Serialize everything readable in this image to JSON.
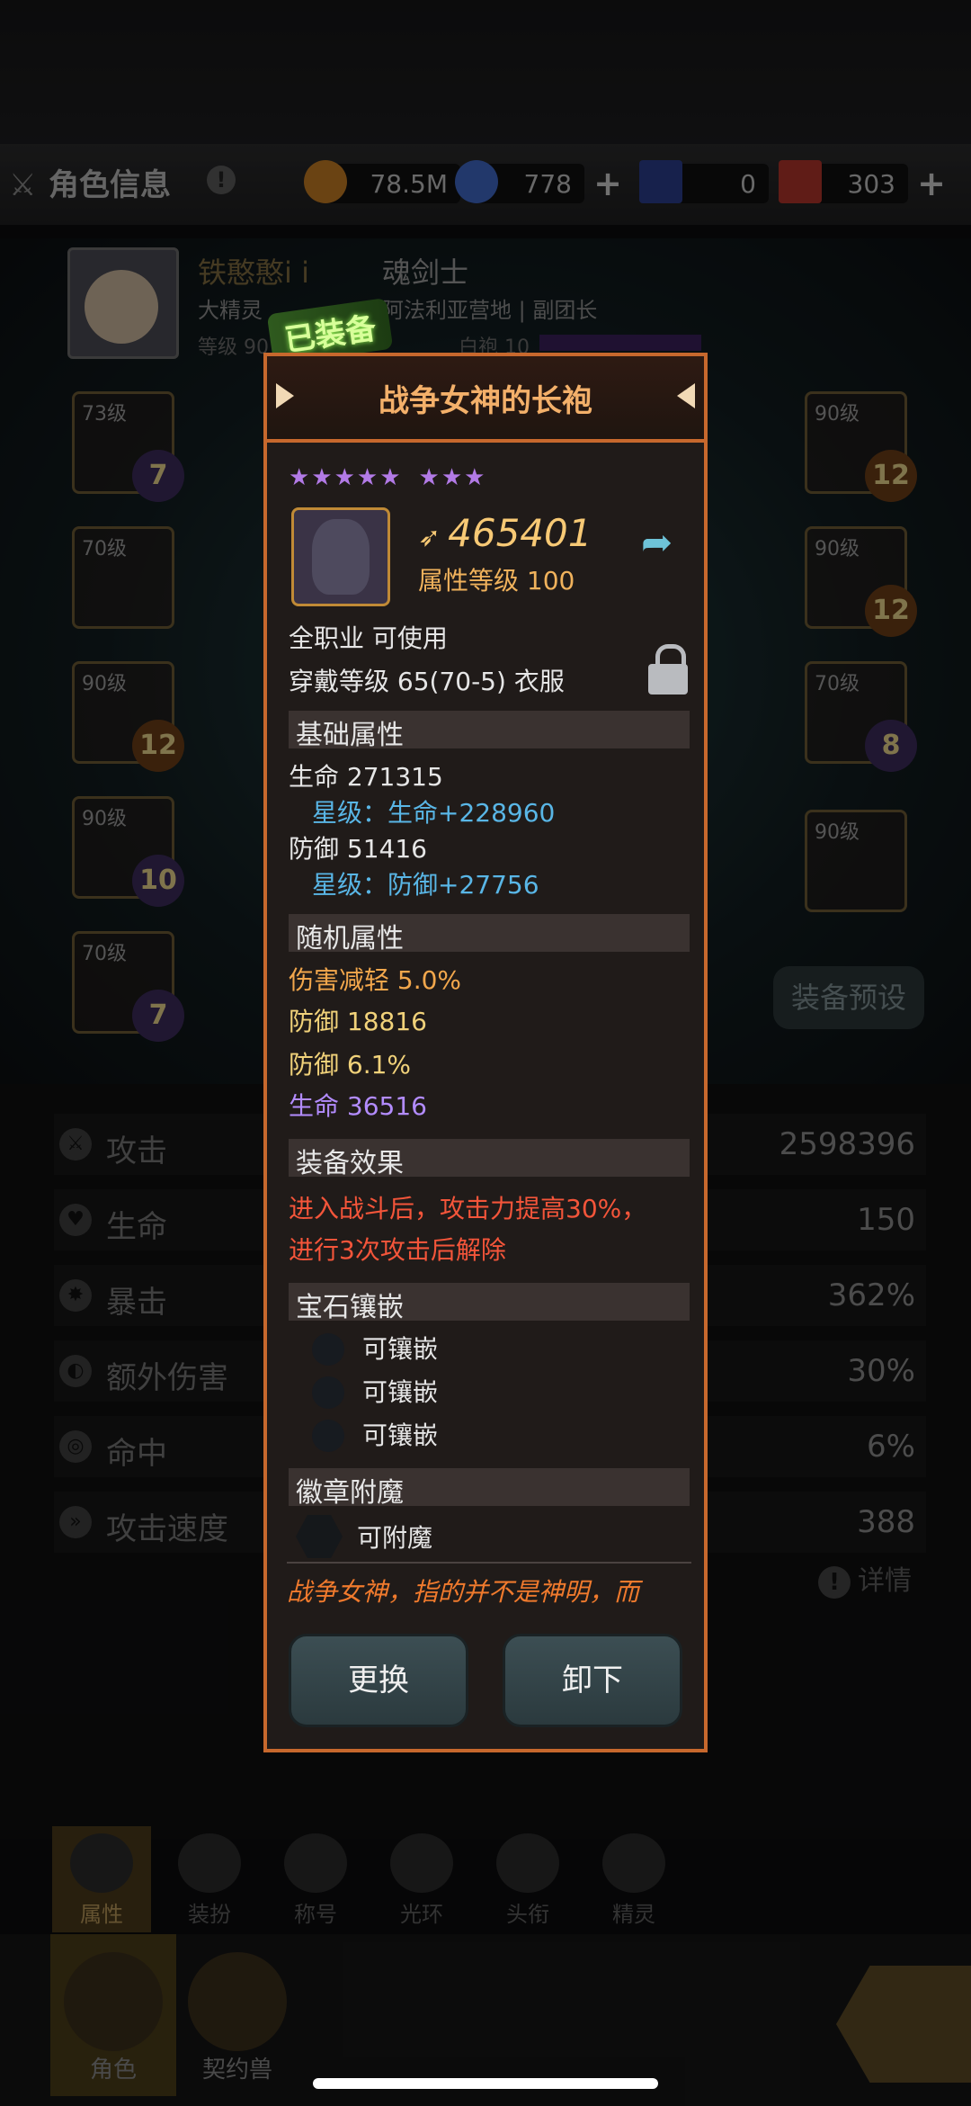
{
  "topbar": {
    "title": "角色信息",
    "info_icon": "!",
    "resources": [
      {
        "name": "gold",
        "value": "78.5M",
        "has_plus": false,
        "color": "#c27a24"
      },
      {
        "name": "crystal",
        "value": "778",
        "has_plus": true,
        "color": "#3e66c4"
      },
      {
        "name": "ticket",
        "value": "0",
        "has_plus": false,
        "color": "#2a3d8a"
      },
      {
        "name": "gift",
        "value": "303",
        "has_plus": true,
        "color": "#b0332a"
      }
    ],
    "plus": "+"
  },
  "profile": {
    "name": "铁憨憨i i",
    "class": "魂剑士",
    "line2": "大精灵 ",
    "guild": "阿法利亚营地 | 副团长",
    "level": "等级 90",
    "robe": "白袍 10"
  },
  "equipped_badge": "已装备",
  "slots": [
    {
      "lv": "73级",
      "star": "7",
      "tone": "purple"
    },
    {
      "lv": "70级",
      "star": "",
      "tone": "purple"
    },
    {
      "lv": "90级",
      "star": "12",
      "tone": "orange"
    },
    {
      "lv": "90级",
      "star": "10",
      "tone": "purple"
    },
    {
      "lv": "70级",
      "star": "7",
      "tone": "purple"
    },
    {
      "lv": "90级",
      "star": "12",
      "tone": "orange"
    },
    {
      "lv": "90级",
      "star": "12",
      "tone": "orange"
    },
    {
      "lv": "70级",
      "star": "8",
      "tone": "purple"
    },
    {
      "lv": "90级",
      "star": "",
      "tone": "orange"
    }
  ],
  "preset_button": "装备预设",
  "stats": [
    {
      "label": "攻击",
      "value": "2598396"
    },
    {
      "label": "生命",
      "value": "150"
    },
    {
      "label": "暴击",
      "value": "362%"
    },
    {
      "label": "额外伤害",
      "value": "30%"
    },
    {
      "label": "命中",
      "value": "6%"
    },
    {
      "label": "攻击速度",
      "value": "388"
    }
  ],
  "detail_link": "详情",
  "tabs": [
    {
      "label": "属性",
      "active": true
    },
    {
      "label": "装扮",
      "active": false
    },
    {
      "label": "称号",
      "active": false
    },
    {
      "label": "光环",
      "active": false
    },
    {
      "label": "头衔",
      "active": false
    },
    {
      "label": "精灵",
      "active": false
    }
  ],
  "bottom_nav": [
    {
      "label": "角色",
      "active": true
    },
    {
      "label": "契约兽",
      "active": false
    }
  ],
  "popup": {
    "title": "战争女神的长袍",
    "stars_a": "★★★★★",
    "stars_b": "★★★",
    "power": "465401",
    "attr_level": "属性等级 100",
    "job": "全职业 可使用",
    "wear": "穿戴等级 65(70-5) 衣服",
    "sections": {
      "base": "基础属性",
      "random": "随机属性",
      "effect": "装备效果",
      "gems": "宝石镶嵌",
      "badge": "徽章附魔"
    },
    "base_attrs": [
      {
        "text": "生命  271315",
        "kind": "white"
      },
      {
        "text": "星级：生命+228960",
        "kind": "blue"
      },
      {
        "text": "防御  51416",
        "kind": "white"
      },
      {
        "text": "星级：防御+27756",
        "kind": "blue"
      }
    ],
    "random_attrs": [
      {
        "text": "伤害减轻    5.0%",
        "kind": "orange"
      },
      {
        "text": "防御    18816",
        "kind": "yellow"
      },
      {
        "text": "防御    6.1%",
        "kind": "yellow"
      },
      {
        "text": "生命    36516",
        "kind": "purple"
      }
    ],
    "effect_lines": [
      "进入战斗后，攻击力提高30%，",
      "进行3次攻击后解除"
    ],
    "gem_slots": [
      "可镶嵌",
      "可镶嵌",
      "可镶嵌"
    ],
    "badge_slot": "可附魔",
    "flavor": "战争女神，指的并不是神明，而",
    "button_replace": "更换",
    "button_unequip": "卸下"
  }
}
